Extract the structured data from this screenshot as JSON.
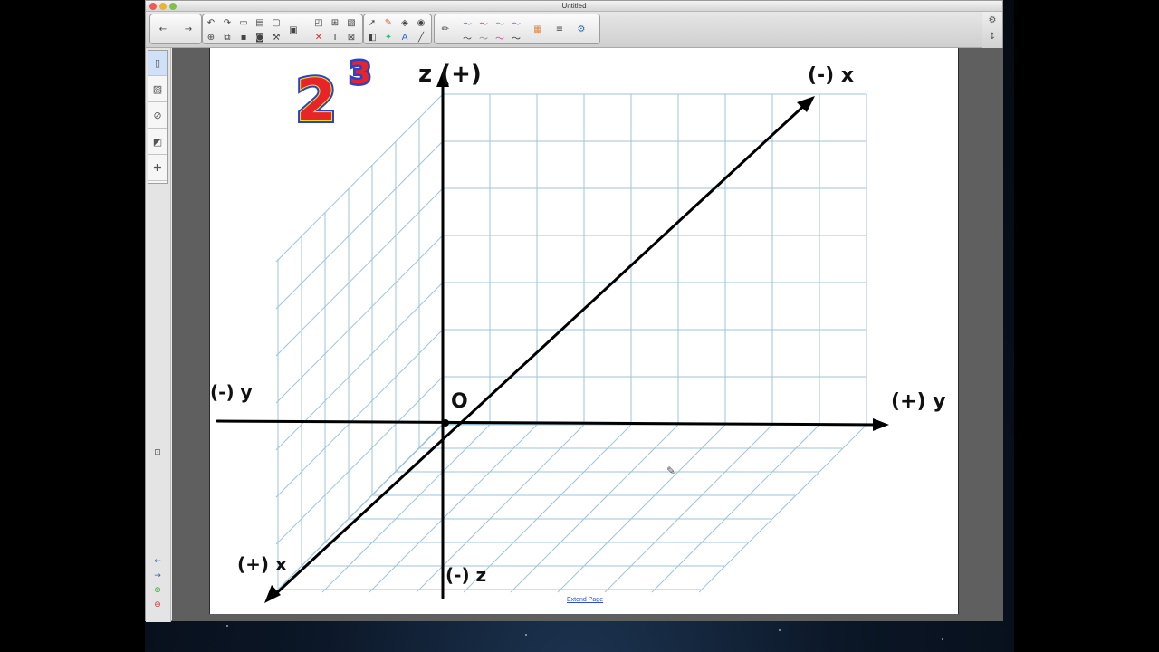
{
  "window": {
    "title": "Untitled"
  },
  "toolbar": {
    "back_icon": "arrow-left-icon",
    "forward_icon": "arrow-right-icon"
  },
  "sidebar": {
    "tabs": [
      "page-sorter-icon",
      "gallery-icon",
      "attachments-icon",
      "properties-icon",
      "addons-icon"
    ]
  },
  "canvas": {
    "superscript_base": "2",
    "superscript_exp": "3",
    "labels": {
      "z_top": "z (+)",
      "x_neg": "(-) x",
      "y_neg": "(-) y",
      "y_pos": "(+) y",
      "x_pos": "(+) x",
      "z_neg": "(-) z",
      "origin": "O"
    }
  },
  "footer": {
    "extend_page": "Extend Page"
  },
  "colors": {
    "grid": "#9fc3d8",
    "axis": "#000000",
    "badge_red": "#e8242b",
    "badge_yellow": "#f7e11a",
    "badge_blue": "#2a41c8"
  }
}
